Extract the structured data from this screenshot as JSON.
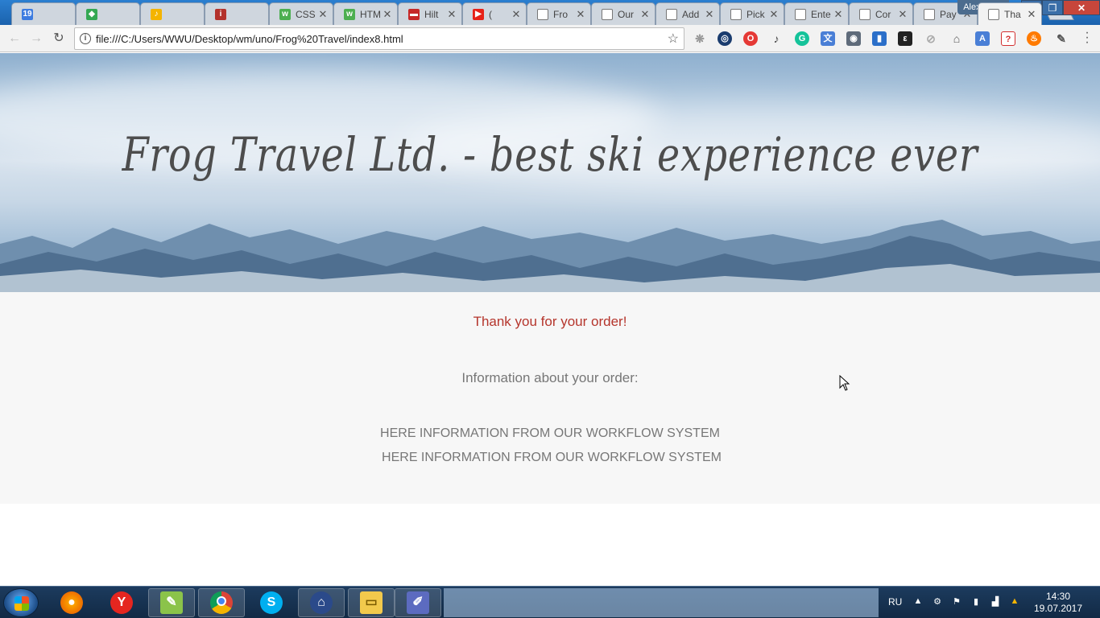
{
  "browser": {
    "tabs": [
      {
        "title": "19",
        "icon": "calendar-icon",
        "color": "#3d7ce0"
      },
      {
        "title": "",
        "icon": "maps-icon",
        "color": "#34a853"
      },
      {
        "title": "",
        "icon": "music-icon",
        "color": "#f4b400"
      },
      {
        "title": "",
        "icon": "info-icon",
        "color": "#b3322c"
      },
      {
        "title": "CSS",
        "icon": "w3-icon",
        "color": "#4caf50"
      },
      {
        "title": "HTM",
        "icon": "w3-icon",
        "color": "#4caf50"
      },
      {
        "title": "Hilt",
        "icon": "hilton-icon",
        "color": "#c62828"
      },
      {
        "title": "(",
        "icon": "youtube-icon",
        "color": "#e62117"
      },
      {
        "title": "Fro",
        "icon": "page-icon",
        "color": ""
      },
      {
        "title": "Our",
        "icon": "page-icon",
        "color": ""
      },
      {
        "title": "Add",
        "icon": "page-icon",
        "color": ""
      },
      {
        "title": "Pick",
        "icon": "page-icon",
        "color": ""
      },
      {
        "title": "Ente",
        "icon": "page-icon",
        "color": ""
      },
      {
        "title": "Cor",
        "icon": "page-icon",
        "color": ""
      },
      {
        "title": "Pay",
        "icon": "page-icon",
        "color": ""
      },
      {
        "title": "Tha",
        "icon": "page-icon",
        "color": "",
        "active": true
      }
    ],
    "user_name": "Alexandra",
    "address": "file:///C:/Users/WWU/Desktop/wm/uno/Frog%20Travel/index8.html"
  },
  "page": {
    "hero_title": "Frog Travel Ltd. - best ski experience ever",
    "thank_you": "Thank you for your order!",
    "info_heading": "Information about your order:",
    "workflow_lines": [
      "HERE INFORMATION FROM OUR WORKFLOW SYSTEM",
      "HERE INFORMATION FROM OUR WORKFLOW SYSTEM"
    ]
  },
  "taskbar": {
    "language": "RU",
    "time": "14:30",
    "date": "19.07.2017",
    "apps": [
      "firefox-icon",
      "yandex-icon",
      "notepad-icon",
      "chrome-icon",
      "skype-icon",
      "keepass-icon",
      "explorer-icon",
      "editor-icon"
    ]
  },
  "colors": {
    "accent_red": "#b5352c",
    "text_gray": "#777777",
    "title_gray": "#4d4d4d"
  }
}
